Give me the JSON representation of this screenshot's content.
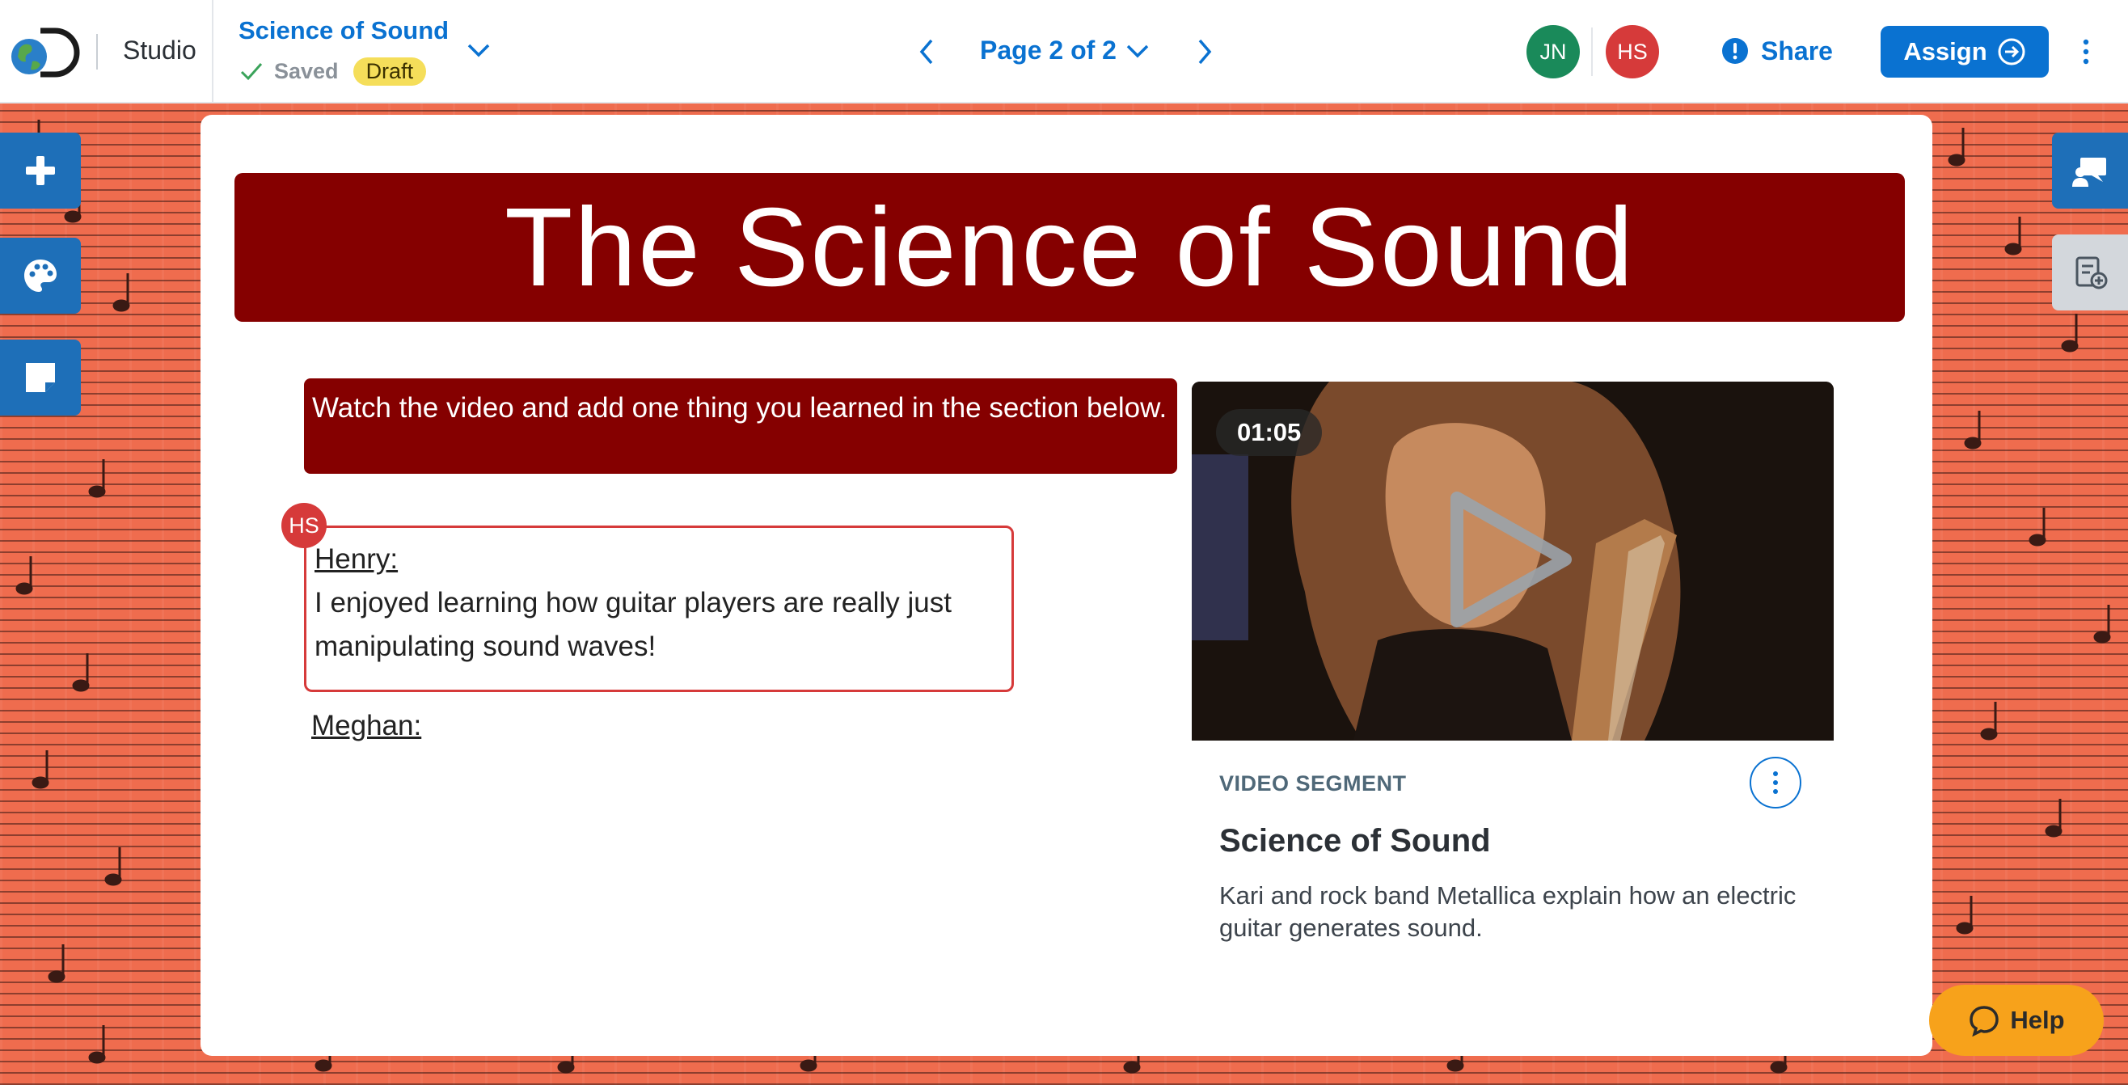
{
  "header": {
    "app_name": "Studio",
    "doc_title": "Science of Sound",
    "saved_label": "Saved",
    "status_badge": "Draft",
    "page_label": "Page 2 of 2",
    "collaborators": [
      "JN",
      "HS"
    ],
    "share_label": "Share",
    "assign_label": "Assign"
  },
  "tools": {
    "left": [
      "plus-icon",
      "palette-icon",
      "sticky-note-icon"
    ],
    "right": [
      "comments-icon",
      "standards-icon"
    ]
  },
  "canvas": {
    "banner_title": "The Science of Sound",
    "instructions": "Watch the video and add one thing you learned in the section below.",
    "responses": [
      {
        "author_initials": "HS",
        "name": "Henry:",
        "text": "I enjoyed learning how guitar players are really just manipulating sound waves!"
      },
      {
        "name": "Meghan:"
      }
    ],
    "video": {
      "duration": "01:05",
      "segment_label": "VIDEO SEGMENT",
      "title": "Science of Sound",
      "description": "Kari and rock band Metallica explain how an electric guitar generates sound."
    }
  },
  "help_label": "Help",
  "colors": {
    "brand_blue": "#0a72d1",
    "banner_red": "#850000",
    "background_orange": "#ef6c4e",
    "help_orange": "#f7a21b",
    "draft_yellow": "#f5de5a"
  }
}
